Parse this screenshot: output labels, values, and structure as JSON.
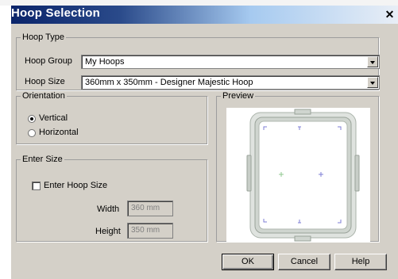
{
  "window": {
    "title": "Hoop Selection",
    "close_glyph": "✕"
  },
  "hoop_type": {
    "legend": "Hoop Type",
    "group_label": "Hoop Group",
    "group_value": "My Hoops",
    "size_label": "Hoop Size",
    "size_value": "360mm x 350mm - Designer Majestic Hoop"
  },
  "orientation": {
    "legend": "Orientation",
    "options": [
      {
        "label": "Vertical",
        "selected": true
      },
      {
        "label": "Horizontal",
        "selected": false
      }
    ]
  },
  "enter_size": {
    "legend": "Enter Size",
    "checkbox_label": "Enter Hoop Size",
    "checked": false,
    "width_label": "Width",
    "width_value": "360 mm",
    "height_label": "Height",
    "height_value": "350 mm"
  },
  "preview": {
    "legend": "Preview"
  },
  "buttons": {
    "ok": "OK",
    "cancel": "Cancel",
    "help": "Help"
  },
  "icons": [
    "close-icon",
    "dropdown-arrow-icon",
    "radio-icon",
    "checkbox-icon",
    "hoop-icon",
    "crosshair-icon"
  ],
  "colors": {
    "title_start": "#0a246a",
    "title_end": "#e8eef6",
    "face": "#d4d0c8",
    "hoop": "#c4ccc4",
    "marks": "#7d7dd6",
    "center_mark": "#8fc78f"
  }
}
